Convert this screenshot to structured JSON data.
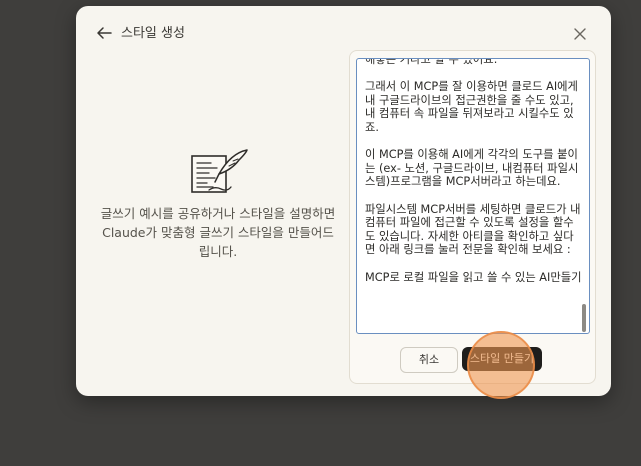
{
  "dialog": {
    "title": "스타일 생성",
    "help_text": "글쓰기 예시를 공유하거나 스타일을 설명하면 Claude가 맞춤형 글쓰기 스타일을 만들어드립니다.",
    "textarea": {
      "paragraphs": [
        "해놓은 거라고 할 수 있어요.",
        "그래서 이 MCP를 잘 이용하면 클로드 AI에게 내 구글드라이브의 접근권한을 줄 수도 있고, 내 컴퓨터 속 파일을 뒤져보라고 시킬수도 있죠.",
        "이 MCP를 이용해 AI에게 각각의 도구를 붙이는 (ex- 노션, 구글드라이브, 내컴퓨터 파일시스템)프로그램을 MCP서버라고 하는데요.",
        "파일시스템 MCP서버를 세팅하면 클로드가 내 컴퓨터 파일에 접근할 수 있도록 설정을 할수도 있습니다. 자세한 아티클을 확인하고 싶다면 아래 링크를 눌러 전문을 확인해 보세요 :",
        "MCP로 로컬 파일을 읽고 쓸 수 있는 AI만들기"
      ]
    },
    "buttons": {
      "cancel": "취소",
      "create": "스타일 만들기"
    }
  },
  "icons": {
    "back": "arrow-left-icon",
    "close": "close-icon",
    "illustration": "document-quill-icon"
  },
  "colors": {
    "dialog_bg": "#f7f5ef",
    "backdrop": "#3f3e3c",
    "primary_button": "#1f1e1c",
    "click_indicator": "#f0a060"
  }
}
